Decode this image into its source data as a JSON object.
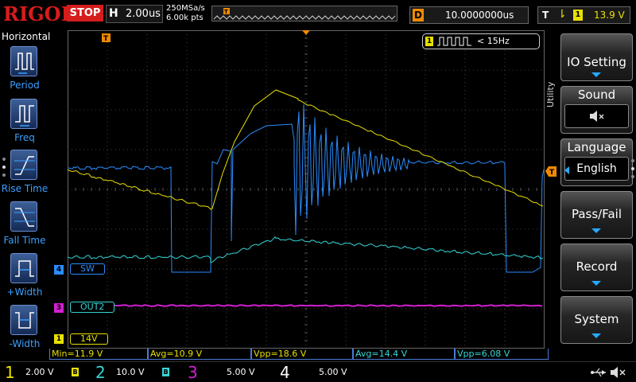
{
  "brand": "RIGOL",
  "status": "STOP",
  "timebase": {
    "label": "H",
    "value": "2.00us"
  },
  "sample": {
    "rate": "250MSa/s",
    "points": "6.00k pts"
  },
  "trigger_pos_marker": "T",
  "delay": {
    "label": "D",
    "value": "10.0000000us"
  },
  "trigger": {
    "label": "T",
    "slope": "⇂",
    "channel": "1",
    "level": "13.9 V"
  },
  "left_panel": {
    "title": "Horizontal",
    "items": [
      {
        "label": "Period",
        "icon": "period-icon"
      },
      {
        "label": "Freq",
        "icon": "freq-icon"
      },
      {
        "label": "Rise Time",
        "icon": "rise-time-icon"
      },
      {
        "label": "Fall Time",
        "icon": "fall-time-icon"
      },
      {
        "label": "+Width",
        "icon": "pos-width-icon"
      },
      {
        "label": "-Width",
        "icon": "neg-width-icon"
      }
    ]
  },
  "freq_chip": {
    "channel": "1",
    "value": "< 15Hz"
  },
  "channel_labels": {
    "ch4": {
      "num": "4",
      "name": "SW"
    },
    "ch3": {
      "num": "3",
      "name": "OUT2"
    },
    "ch1": {
      "num": "1",
      "name": "14V"
    },
    "trig_level_marker": "T"
  },
  "measurements": [
    {
      "text": "Min=11.9 V",
      "color": "yellow"
    },
    {
      "text": "Avg=10.9 V",
      "color": "yellow"
    },
    {
      "text": "Vpp=18.6 V",
      "color": "yellow"
    },
    {
      "text": "Avg=14.4 V",
      "color": "cyan"
    },
    {
      "text": "Vpp=6.08 V",
      "color": "cyan"
    }
  ],
  "channels": [
    {
      "num": "1",
      "scale": "2.00 V",
      "color": "#e8e000",
      "bw": "B"
    },
    {
      "num": "2",
      "scale": "10.0 V",
      "color": "#35d6d6",
      "bw": "B"
    },
    {
      "num": "3",
      "scale": "5.00 V",
      "color": "#d21fd2",
      "bw": ""
    },
    {
      "num": "4",
      "scale": "5.00 V",
      "color": "#2a8cff",
      "bw": ""
    }
  ],
  "right_menu": {
    "utility_label": "Utility",
    "items": [
      {
        "label": "IO Setting"
      },
      {
        "label": "Sound",
        "value": "🔈̸"
      },
      {
        "label": "Language",
        "value": "English"
      },
      {
        "label": "Pass/Fail"
      },
      {
        "label": "Record"
      },
      {
        "label": "System"
      }
    ]
  },
  "colors": {
    "ch1": "#e8e000",
    "ch2": "#35d6d6",
    "ch3": "#d21fd2",
    "ch4": "#2a8cff",
    "accent": "#1f5fd6"
  }
}
